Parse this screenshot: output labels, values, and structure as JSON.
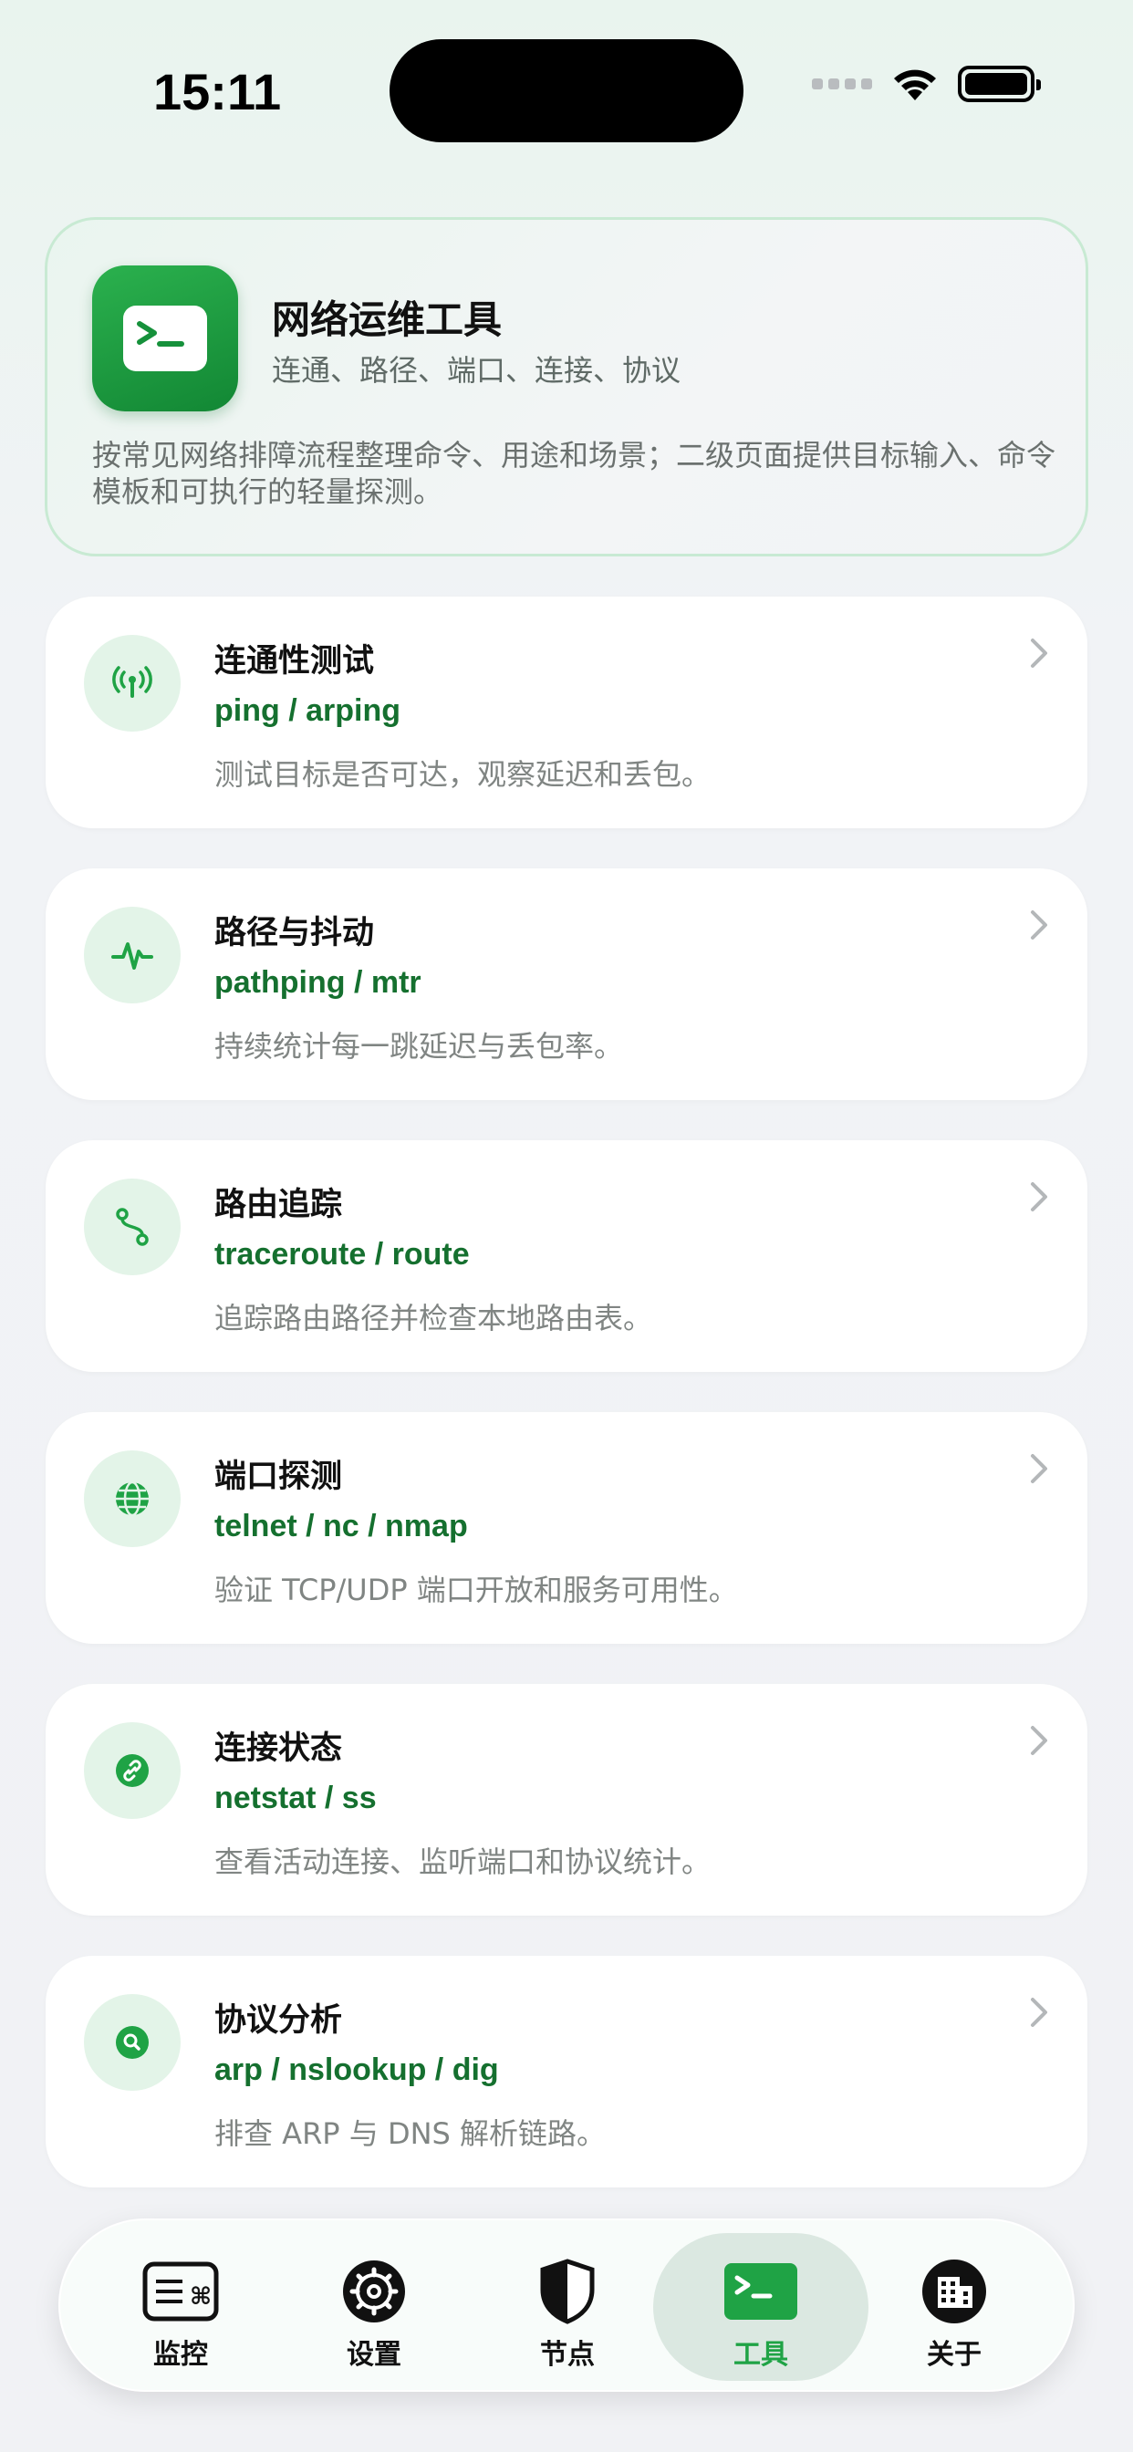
{
  "status_bar": {
    "time": "15:11"
  },
  "header": {
    "title": "网络运维工具",
    "subtitle": "连通、路径、端口、连接、协议",
    "description": "按常见网络排障流程整理命令、用途和场景；二级页面提供目标输入、命令模板和可执行的轻量探测。"
  },
  "tools": [
    {
      "title": "连通性测试",
      "commands": "ping / arping",
      "description": "测试目标是否可达，观察延迟和丢包。",
      "icon": "antenna-icon"
    },
    {
      "title": "路径与抖动",
      "commands": "pathping / mtr",
      "description": "持续统计每一跳延迟与丢包率。",
      "icon": "waveform-icon"
    },
    {
      "title": "路由追踪",
      "commands": "traceroute / route",
      "description": "追踪路由路径并检查本地路由表。",
      "icon": "route-icon"
    },
    {
      "title": "端口探测",
      "commands": "telnet / nc / nmap",
      "description": "验证 TCP/UDP 端口开放和服务可用性。",
      "icon": "globe-icon"
    },
    {
      "title": "连接状态",
      "commands": "netstat / ss",
      "description": "查看活动连接、监听端口和协议统计。",
      "icon": "link-icon"
    },
    {
      "title": "协议分析",
      "commands": "arp / nslookup / dig",
      "description": "排查 ARP 与 DNS 解析链路。",
      "icon": "search-icon"
    }
  ],
  "tabbar": {
    "tabs": [
      {
        "label": "监控",
        "icon": "keyboard-icon"
      },
      {
        "label": "设置",
        "icon": "gear-icon"
      },
      {
        "label": "节点",
        "icon": "shield-icon"
      },
      {
        "label": "工具",
        "icon": "terminal-icon",
        "active": true
      },
      {
        "label": "关于",
        "icon": "building-icon"
      }
    ]
  },
  "colors": {
    "accent": "#1fa345",
    "command_text": "#15702f",
    "icon_bg": "#e3f4e8"
  }
}
